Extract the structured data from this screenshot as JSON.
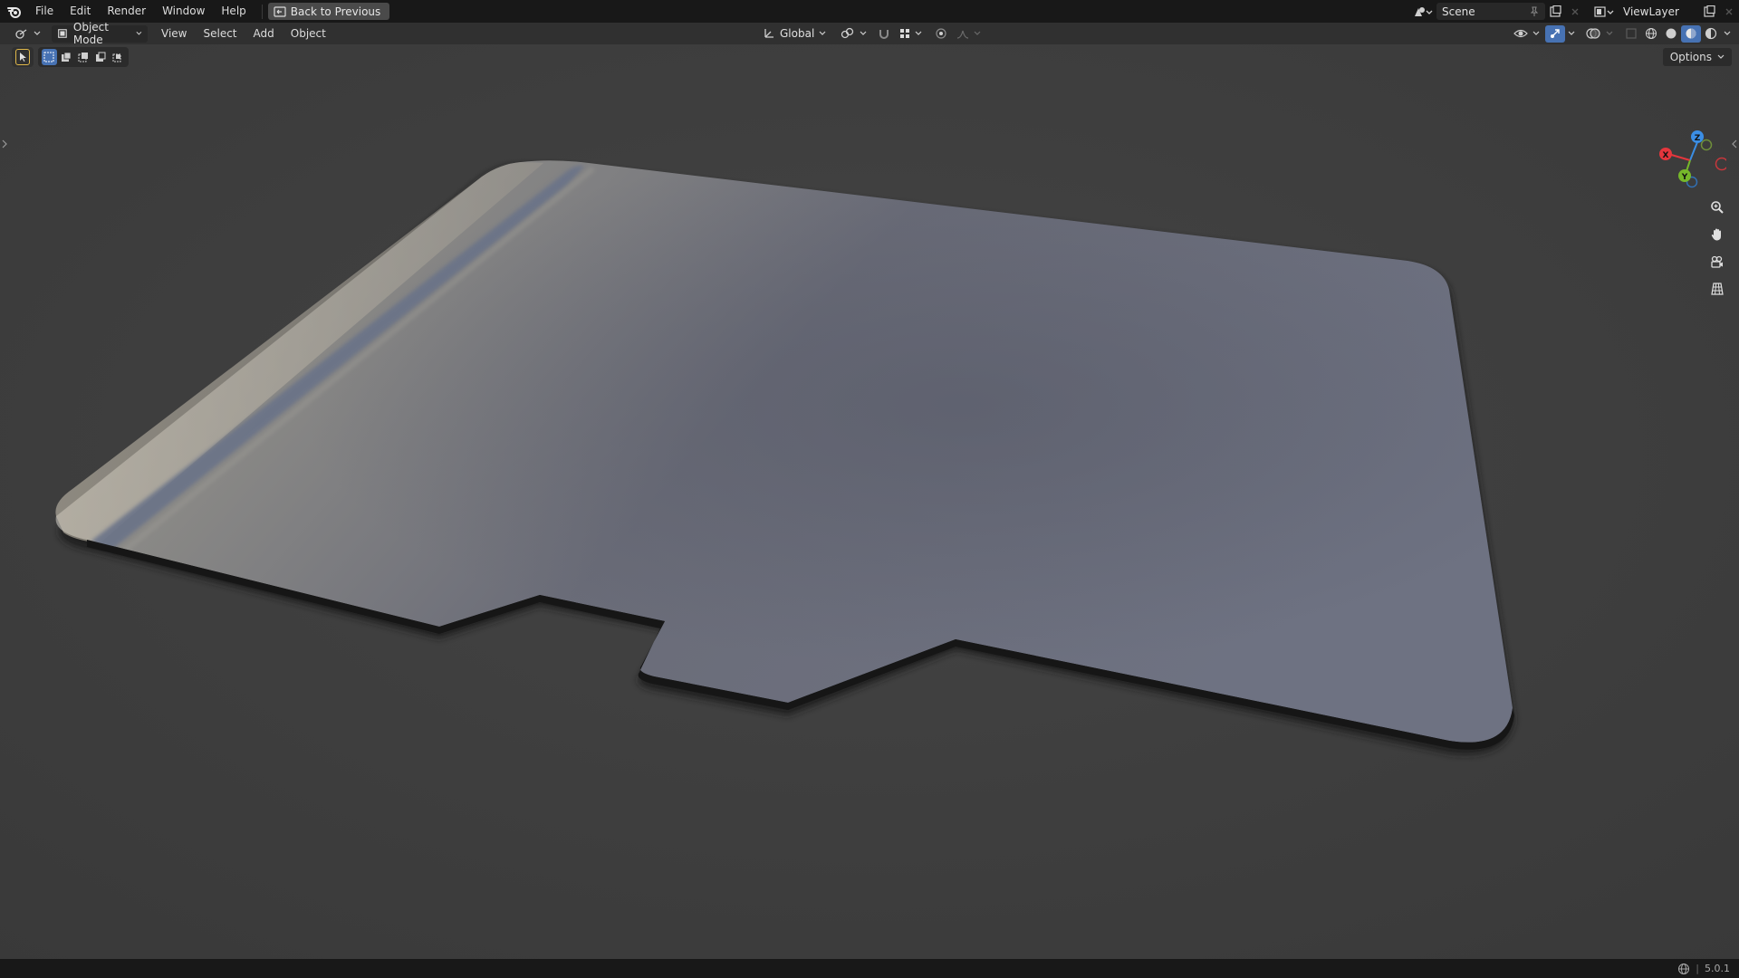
{
  "topbar": {
    "menu": [
      "File",
      "Edit",
      "Render",
      "Window",
      "Help"
    ],
    "back_label": "Back to Previous",
    "scene_name": "Scene",
    "view_layer": "ViewLayer"
  },
  "header": {
    "mode": "Object Mode",
    "menus": [
      "View",
      "Select",
      "Add",
      "Object"
    ],
    "transform_orientation": "Global"
  },
  "toolrow": {
    "options_label": "Options"
  },
  "gizmo": {
    "x_label": "X",
    "y_label": "Y",
    "z_label": "Z",
    "x_color": "#e5363d",
    "y_color": "#76b82a",
    "z_color": "#3b8ee5"
  },
  "nav_tools": [
    "zoom-icon",
    "pan-hand-icon",
    "camera-icon",
    "ortho-grid-icon"
  ],
  "statusbar": {
    "version": "5.0.1"
  },
  "colors": {
    "viewport_bg": "#3d3d3d",
    "topbar_bg": "#181818",
    "header_bg": "#303030",
    "accent": "#4772b3"
  }
}
